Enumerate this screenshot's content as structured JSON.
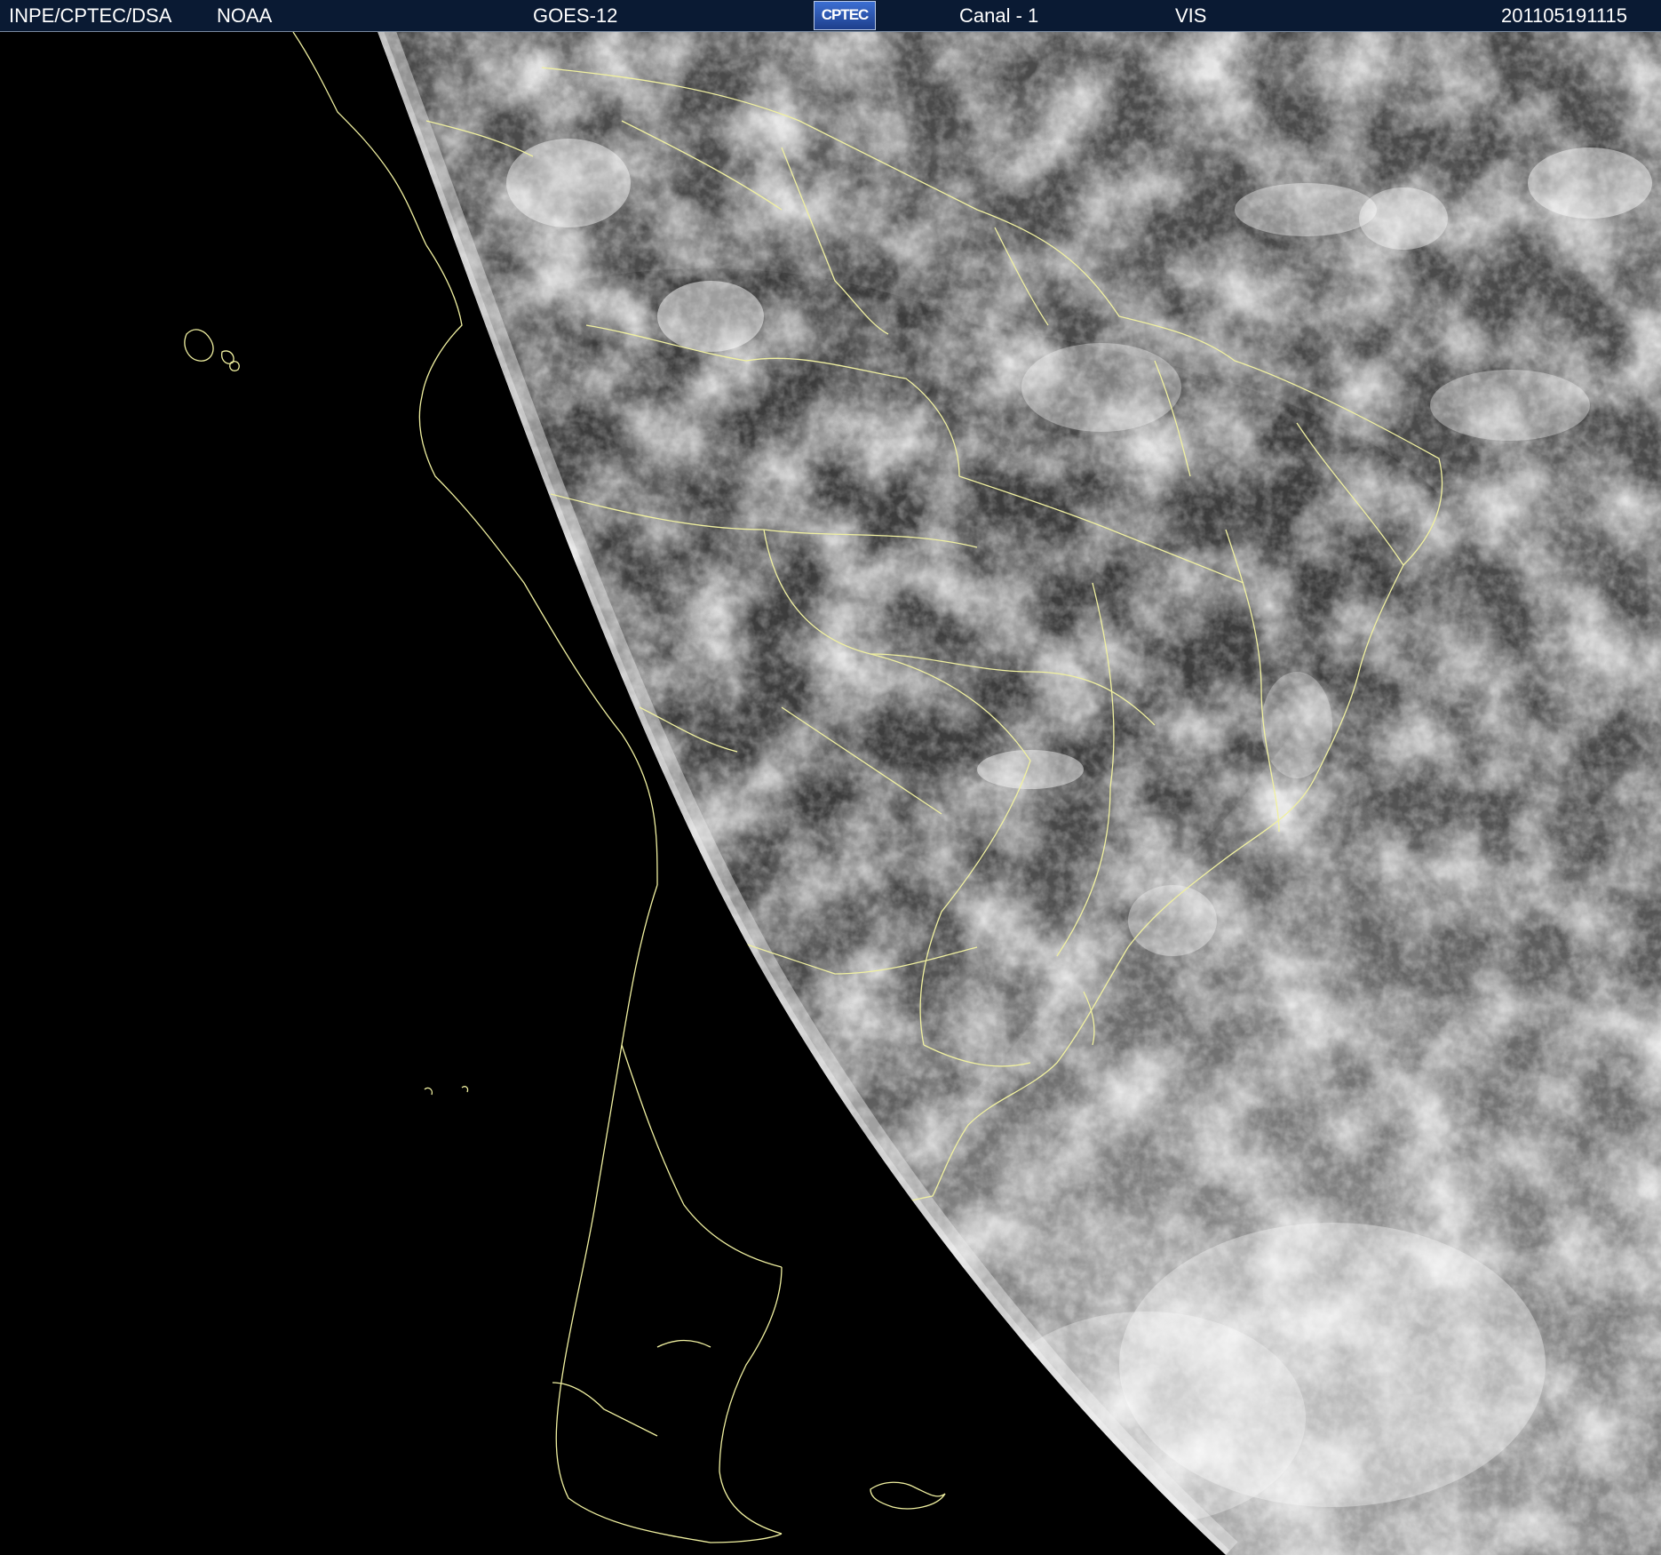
{
  "header": {
    "agency": "INPE/CPTEC/DSA",
    "source": "NOAA",
    "satellite": "GOES-12",
    "logo_text": "CPTEC",
    "channel": "Canal - 1",
    "band": "VIS",
    "timestamp": "201105191115"
  },
  "colors": {
    "header_background": "#0a1a33",
    "header_text": "#ffffff",
    "space": "#000000",
    "border_lines": "#f0f0a0"
  },
  "image": {
    "type": "satellite-visible-channel",
    "region": "South America",
    "icons": [
      "cptec-logo-icon"
    ]
  }
}
